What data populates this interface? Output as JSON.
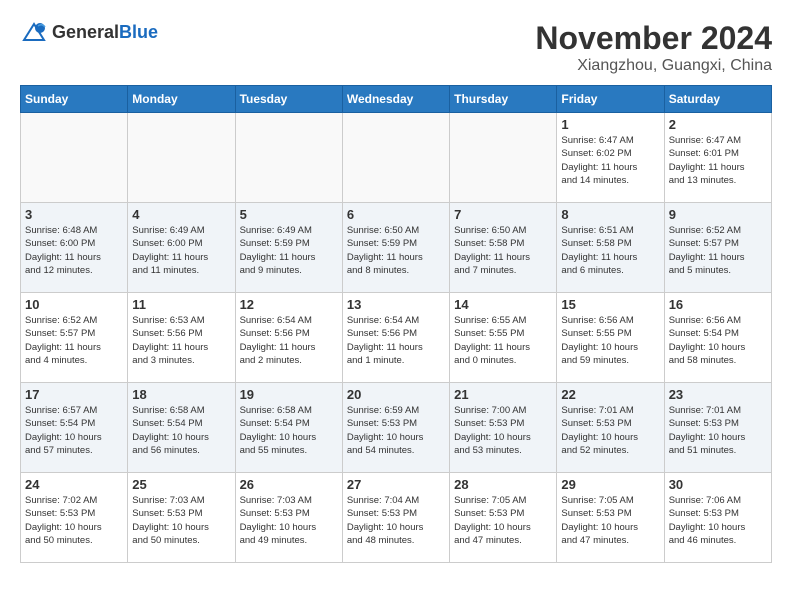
{
  "header": {
    "logo_general": "General",
    "logo_blue": "Blue",
    "month_title": "November 2024",
    "location": "Xiangzhou, Guangxi, China"
  },
  "weekdays": [
    "Sunday",
    "Monday",
    "Tuesday",
    "Wednesday",
    "Thursday",
    "Friday",
    "Saturday"
  ],
  "weeks": [
    [
      {
        "day": "",
        "info": ""
      },
      {
        "day": "",
        "info": ""
      },
      {
        "day": "",
        "info": ""
      },
      {
        "day": "",
        "info": ""
      },
      {
        "day": "",
        "info": ""
      },
      {
        "day": "1",
        "info": "Sunrise: 6:47 AM\nSunset: 6:02 PM\nDaylight: 11 hours\nand 14 minutes."
      },
      {
        "day": "2",
        "info": "Sunrise: 6:47 AM\nSunset: 6:01 PM\nDaylight: 11 hours\nand 13 minutes."
      }
    ],
    [
      {
        "day": "3",
        "info": "Sunrise: 6:48 AM\nSunset: 6:00 PM\nDaylight: 11 hours\nand 12 minutes."
      },
      {
        "day": "4",
        "info": "Sunrise: 6:49 AM\nSunset: 6:00 PM\nDaylight: 11 hours\nand 11 minutes."
      },
      {
        "day": "5",
        "info": "Sunrise: 6:49 AM\nSunset: 5:59 PM\nDaylight: 11 hours\nand 9 minutes."
      },
      {
        "day": "6",
        "info": "Sunrise: 6:50 AM\nSunset: 5:59 PM\nDaylight: 11 hours\nand 8 minutes."
      },
      {
        "day": "7",
        "info": "Sunrise: 6:50 AM\nSunset: 5:58 PM\nDaylight: 11 hours\nand 7 minutes."
      },
      {
        "day": "8",
        "info": "Sunrise: 6:51 AM\nSunset: 5:58 PM\nDaylight: 11 hours\nand 6 minutes."
      },
      {
        "day": "9",
        "info": "Sunrise: 6:52 AM\nSunset: 5:57 PM\nDaylight: 11 hours\nand 5 minutes."
      }
    ],
    [
      {
        "day": "10",
        "info": "Sunrise: 6:52 AM\nSunset: 5:57 PM\nDaylight: 11 hours\nand 4 minutes."
      },
      {
        "day": "11",
        "info": "Sunrise: 6:53 AM\nSunset: 5:56 PM\nDaylight: 11 hours\nand 3 minutes."
      },
      {
        "day": "12",
        "info": "Sunrise: 6:54 AM\nSunset: 5:56 PM\nDaylight: 11 hours\nand 2 minutes."
      },
      {
        "day": "13",
        "info": "Sunrise: 6:54 AM\nSunset: 5:56 PM\nDaylight: 11 hours\nand 1 minute."
      },
      {
        "day": "14",
        "info": "Sunrise: 6:55 AM\nSunset: 5:55 PM\nDaylight: 11 hours\nand 0 minutes."
      },
      {
        "day": "15",
        "info": "Sunrise: 6:56 AM\nSunset: 5:55 PM\nDaylight: 10 hours\nand 59 minutes."
      },
      {
        "day": "16",
        "info": "Sunrise: 6:56 AM\nSunset: 5:54 PM\nDaylight: 10 hours\nand 58 minutes."
      }
    ],
    [
      {
        "day": "17",
        "info": "Sunrise: 6:57 AM\nSunset: 5:54 PM\nDaylight: 10 hours\nand 57 minutes."
      },
      {
        "day": "18",
        "info": "Sunrise: 6:58 AM\nSunset: 5:54 PM\nDaylight: 10 hours\nand 56 minutes."
      },
      {
        "day": "19",
        "info": "Sunrise: 6:58 AM\nSunset: 5:54 PM\nDaylight: 10 hours\nand 55 minutes."
      },
      {
        "day": "20",
        "info": "Sunrise: 6:59 AM\nSunset: 5:53 PM\nDaylight: 10 hours\nand 54 minutes."
      },
      {
        "day": "21",
        "info": "Sunrise: 7:00 AM\nSunset: 5:53 PM\nDaylight: 10 hours\nand 53 minutes."
      },
      {
        "day": "22",
        "info": "Sunrise: 7:01 AM\nSunset: 5:53 PM\nDaylight: 10 hours\nand 52 minutes."
      },
      {
        "day": "23",
        "info": "Sunrise: 7:01 AM\nSunset: 5:53 PM\nDaylight: 10 hours\nand 51 minutes."
      }
    ],
    [
      {
        "day": "24",
        "info": "Sunrise: 7:02 AM\nSunset: 5:53 PM\nDaylight: 10 hours\nand 50 minutes."
      },
      {
        "day": "25",
        "info": "Sunrise: 7:03 AM\nSunset: 5:53 PM\nDaylight: 10 hours\nand 50 minutes."
      },
      {
        "day": "26",
        "info": "Sunrise: 7:03 AM\nSunset: 5:53 PM\nDaylight: 10 hours\nand 49 minutes."
      },
      {
        "day": "27",
        "info": "Sunrise: 7:04 AM\nSunset: 5:53 PM\nDaylight: 10 hours\nand 48 minutes."
      },
      {
        "day": "28",
        "info": "Sunrise: 7:05 AM\nSunset: 5:53 PM\nDaylight: 10 hours\nand 47 minutes."
      },
      {
        "day": "29",
        "info": "Sunrise: 7:05 AM\nSunset: 5:53 PM\nDaylight: 10 hours\nand 47 minutes."
      },
      {
        "day": "30",
        "info": "Sunrise: 7:06 AM\nSunset: 5:53 PM\nDaylight: 10 hours\nand 46 minutes."
      }
    ]
  ]
}
